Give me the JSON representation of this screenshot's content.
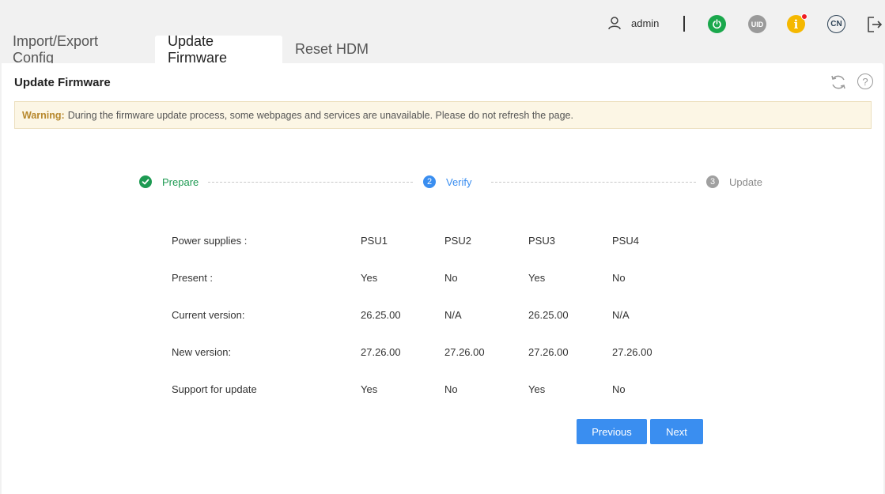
{
  "header": {
    "user_name": "admin",
    "icons": [
      "user-icon",
      "power-icon",
      "uid-icon",
      "info-icon",
      "language-icon",
      "logout-icon"
    ],
    "uid_label": "UID",
    "info_label": "i",
    "language_label": "CN",
    "colors": {
      "power": "#1aa84c",
      "uid": "#9a9a9a",
      "info": "#f5b800",
      "alert_dot": "#ee1c25"
    }
  },
  "tabs": [
    {
      "label": "Import/Export Config",
      "active": false
    },
    {
      "label": "Update Firmware",
      "active": true
    },
    {
      "label": "Reset HDM",
      "active": false
    }
  ],
  "panel": {
    "title": "Update Firmware",
    "help_label": "?"
  },
  "warning": {
    "label": "Warning:",
    "text": "During the firmware update process, some webpages and services are unavailable. Please do not refresh the page."
  },
  "steps": [
    {
      "number": "1",
      "label": "Prepare",
      "state": "done",
      "color": "#1d9a52"
    },
    {
      "number": "2",
      "label": "Verify",
      "state": "current",
      "color": "#3a8ef0"
    },
    {
      "number": "3",
      "label": "Update",
      "state": "pending",
      "color": "#a0a0a0"
    }
  ],
  "table": {
    "rows": [
      {
        "label": "Power supplies :",
        "values": [
          "PSU1",
          "PSU2",
          "PSU3",
          "PSU4"
        ]
      },
      {
        "label": "Present :",
        "values": [
          "Yes",
          "No",
          "Yes",
          "No"
        ]
      },
      {
        "label": "Current version:",
        "values": [
          "26.25.00",
          "N/A",
          "26.25.00",
          "N/A"
        ]
      },
      {
        "label": "New version:",
        "values": [
          "27.26.00",
          "27.26.00",
          "27.26.00",
          "27.26.00"
        ]
      },
      {
        "label": "Support for update",
        "values": [
          "Yes",
          "No",
          "Yes",
          "No"
        ]
      }
    ]
  },
  "buttons": {
    "previous": "Previous",
    "next": "Next",
    "color": "#3a8ef0"
  }
}
